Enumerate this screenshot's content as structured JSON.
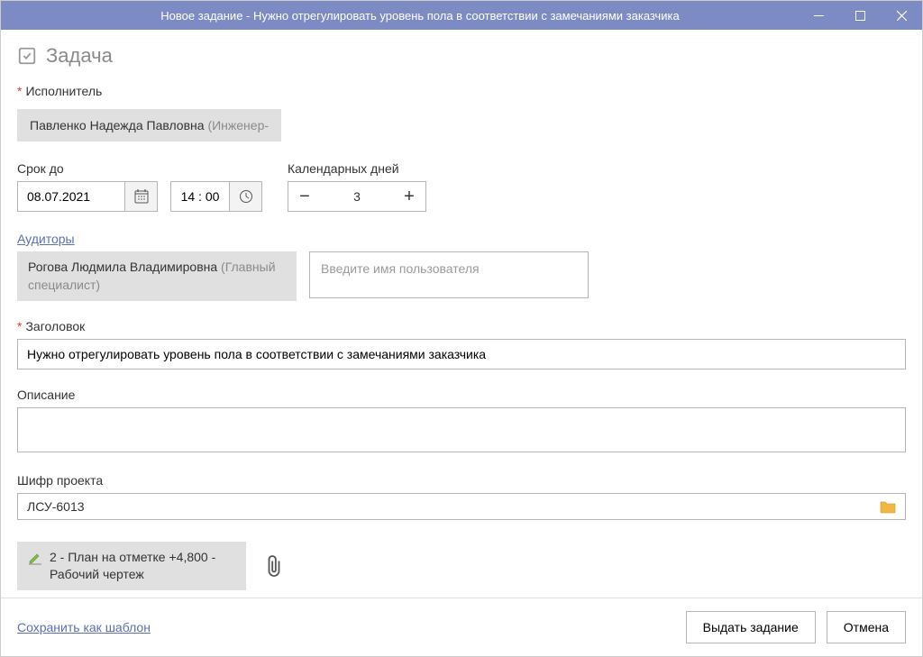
{
  "window": {
    "title": "Новое задание - Нужно отрегулировать уровень пола в соответствии с замечаниями заказчика"
  },
  "header": {
    "title": "Задача"
  },
  "assignee": {
    "label": "Исполнитель",
    "name": "Павленко Надежда Павловна",
    "role": "(Инженер-"
  },
  "deadline": {
    "label": "Срок до",
    "date": "08.07.2021",
    "time": "14 : 00"
  },
  "days": {
    "label": "Календарных дней",
    "value": "3"
  },
  "auditors": {
    "label": "Аудиторы",
    "items": [
      {
        "name": "Рогова Людмила Владимировна",
        "role": "(Главный специалист)"
      }
    ],
    "placeholder": "Введите имя пользователя"
  },
  "title_field": {
    "label": "Заголовок",
    "value": "Нужно отрегулировать уровень пола в соответствии с замечаниями заказчика"
  },
  "description": {
    "label": "Описание",
    "value": ""
  },
  "project": {
    "label": "Шифр проекта",
    "value": "ЛСУ-6013"
  },
  "attachment": {
    "label": "2 - План на отметке +4,800 - Рабочий чертеж"
  },
  "footer": {
    "save_template": "Сохранить как шаблон",
    "submit": "Выдать задание",
    "cancel": "Отмена"
  }
}
